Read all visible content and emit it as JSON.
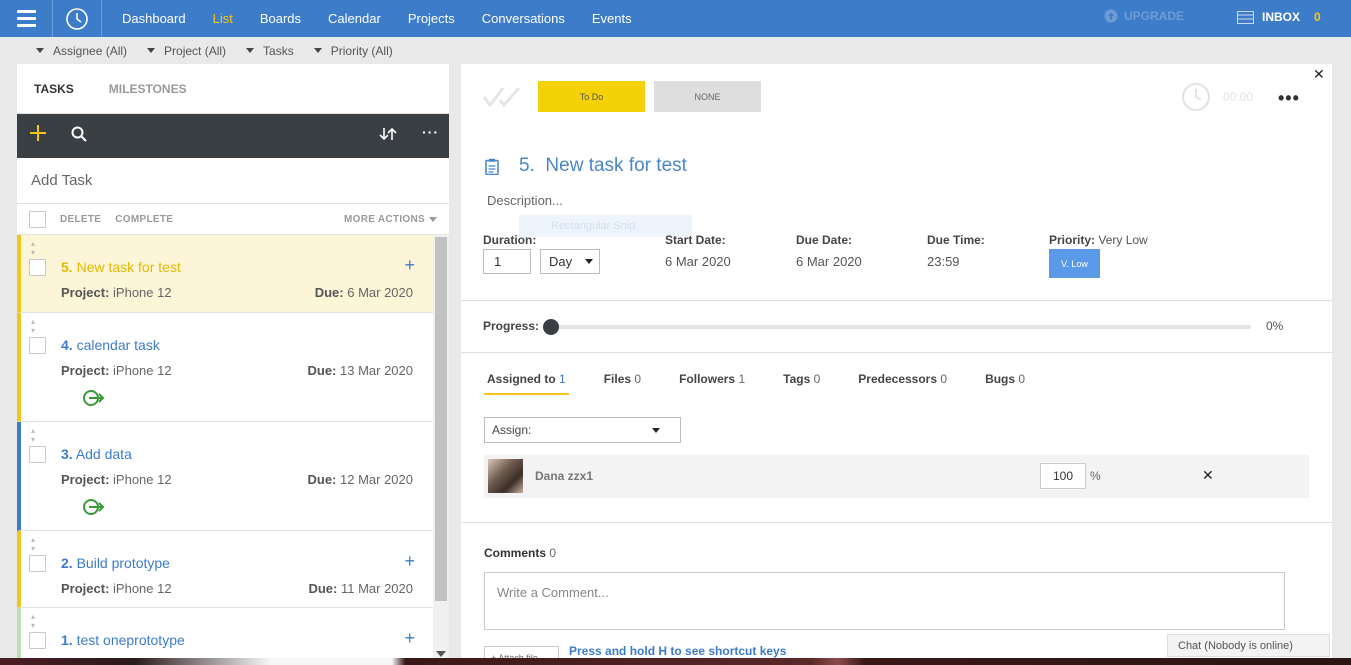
{
  "nav": {
    "items": [
      "Dashboard",
      "List",
      "Boards",
      "Calendar",
      "Projects",
      "Conversations",
      "Events"
    ],
    "active_item": "List",
    "upgrade": "UPGRADE",
    "inbox": "INBOX",
    "inbox_count": "0"
  },
  "filters": [
    "Assignee (All)",
    "Project (All)",
    "Tasks",
    "Priority (All)"
  ],
  "left": {
    "tabs": [
      "TASKS",
      "MILESTONES"
    ],
    "add_task_placeholder": "Add Task",
    "actions": {
      "delete": "DELETE",
      "complete": "COMPLETE",
      "more": "MORE ACTIONS"
    },
    "tasks": [
      {
        "num": "5.",
        "title": "New task for test",
        "project_label": "Project:",
        "project": "iPhone 12",
        "due_label": "Due:",
        "due": "6 Mar 2020",
        "color": "#f5c61a",
        "selected": true,
        "has_plus": true,
        "has_recurring_icon": false
      },
      {
        "num": "4.",
        "title": "calendar task",
        "project_label": "Project:",
        "project": "iPhone 12",
        "due_label": "Due:",
        "due": "13 Mar 2020",
        "color": "#f5c61a",
        "selected": false,
        "has_plus": false,
        "has_recurring_icon": true
      },
      {
        "num": "3.",
        "title": "Add data",
        "project_label": "Project:",
        "project": "iPhone 12",
        "due_label": "Due:",
        "due": "12 Mar 2020",
        "color": "#3d7cc9",
        "selected": false,
        "has_plus": false,
        "has_recurring_icon": true
      },
      {
        "num": "2.",
        "title": "Build prototype",
        "project_label": "Project:",
        "project": "iPhone 12",
        "due_label": "Due:",
        "due": "11 Mar 2020",
        "color": "#f5c61a",
        "selected": false,
        "has_plus": true,
        "has_recurring_icon": false
      },
      {
        "num": "1.",
        "title": "test oneprototype",
        "project_label": "",
        "project": "",
        "due_label": "",
        "due": "",
        "color": "#b9e0b0",
        "selected": false,
        "has_plus": true,
        "has_recurring_icon": false
      }
    ]
  },
  "detail": {
    "status_todo": "To Do",
    "status_none": "NONE",
    "timer": "00:00",
    "task_num": "5.",
    "task_title": "New task for test",
    "description": "Description...",
    "snip_overlay": "Rectangular Snip",
    "duration_label": "Duration:",
    "duration_value": "1",
    "duration_unit": "Day",
    "start_label": "Start Date:",
    "start_value": "6 Mar 2020",
    "due_label": "Due Date:",
    "due_value": "6 Mar 2020",
    "time_label": "Due Time:",
    "time_value": "23:59",
    "priority_label": "Priority:",
    "priority_value": "Very Low",
    "priority_badge": "V. Low",
    "progress_label": "Progress:",
    "progress_value": "0%",
    "progress_fraction": 0,
    "subtabs": [
      {
        "label": "Assigned to",
        "count": "1",
        "active": true
      },
      {
        "label": "Files",
        "count": "0",
        "active": false
      },
      {
        "label": "Followers",
        "count": "1",
        "active": false
      },
      {
        "label": "Tags",
        "count": "0",
        "active": false
      },
      {
        "label": "Predecessors",
        "count": "0",
        "active": false
      },
      {
        "label": "Bugs",
        "count": "0",
        "active": false
      }
    ],
    "assign_placeholder": "Assign:",
    "assignee_name": "Dana zzx1",
    "assignee_pct": "100",
    "pct_sign": "%",
    "comments_label": "Comments",
    "comments_count": "0",
    "comment_placeholder": "Write a Comment...",
    "attach_label": "+ Attach file",
    "shortcut_hint": "Press and hold H to see shortcut keys"
  },
  "chat": "Chat (Nobody is online)"
}
